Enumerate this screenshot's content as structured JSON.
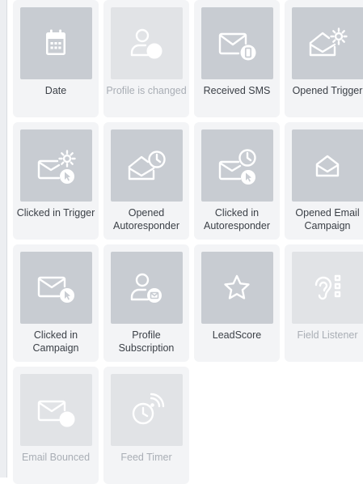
{
  "tiles": [
    {
      "label": "Date",
      "icon": "calendar-icon",
      "disabled": false
    },
    {
      "label": "Profile is changed",
      "icon": "profile-changed-icon",
      "disabled": true
    },
    {
      "label": "Received SMS",
      "icon": "envelope-phone-icon",
      "disabled": false
    },
    {
      "label": "Opened Trigger",
      "icon": "open-envelope-gear-icon",
      "disabled": false
    },
    {
      "label": "Clicked in Trigger",
      "icon": "envelope-gear-cursor-icon",
      "disabled": false
    },
    {
      "label": "Opened Autoresponder",
      "icon": "open-envelope-clock-icon",
      "disabled": false
    },
    {
      "label": "Clicked in Autoresponder",
      "icon": "envelope-clock-cursor-icon",
      "disabled": false
    },
    {
      "label": "Opened Email Campaign",
      "icon": "open-envelope-icon",
      "disabled": false
    },
    {
      "label": "Clicked in Campaign",
      "icon": "envelope-cursor-icon",
      "disabled": false
    },
    {
      "label": "Profile Subscription",
      "icon": "profile-envelope-icon",
      "disabled": false
    },
    {
      "label": "LeadScore",
      "icon": "star-icon",
      "disabled": false
    },
    {
      "label": "Field Listener",
      "icon": "ear-listener-icon",
      "disabled": true
    },
    {
      "label": "Email Bounced",
      "icon": "envelope-clock-bounced-icon",
      "disabled": true
    },
    {
      "label": "Feed Timer",
      "icon": "clock-feed-icon",
      "disabled": true
    }
  ]
}
